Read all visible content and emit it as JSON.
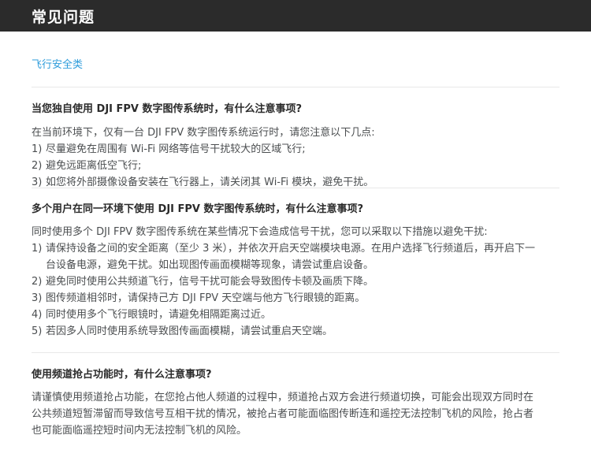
{
  "header": {
    "title": "常见问题"
  },
  "category": {
    "label": "飞行安全类"
  },
  "faqs": [
    {
      "question": "当您独自使用 DJI FPV 数字图传系统时，有什么注意事项?",
      "intro": "在当前环境下，仅有一台 DJI FPV 数字图传系统运行时，请您注意以下几点:",
      "items": [
        {
          "num": "1)",
          "text": "尽量避免在周围有 Wi-Fi 网络等信号干扰较大的区域飞行;"
        },
        {
          "num": "2)",
          "text": "避免远距离低空飞行;"
        },
        {
          "num": "3)",
          "text": "如您将外部摄像设备安装在飞行器上，请关闭其 Wi-Fi 模块，避免干扰。"
        }
      ]
    },
    {
      "question": "多个用户在同一环境下使用 DJI FPV 数字图传系统时，有什么注意事项?",
      "intro": "同时使用多个 DJI FPV 数字图传系统在某些情况下会造成信号干扰，您可以采取以下措施以避免干扰:",
      "items": [
        {
          "num": "1)",
          "text": "请保持设备之间的安全距离（至少 3 米），并依次开启天空端模块电源。在用户选择飞行频道后，再开启下一台设备电源，避免干扰。如出现图传画面模糊等现象，请尝试重启设备。"
        },
        {
          "num": "2)",
          "text": "避免同时使用公共频道飞行，信号干扰可能会导致图传卡顿及画质下降。"
        },
        {
          "num": "3)",
          "text": "图传频道相邻时，请保持己方 DJI FPV 天空端与他方飞行眼镜的距离。"
        },
        {
          "num": "4)",
          "text": "同时使用多个飞行眼镜时，请避免相隔距离过近。"
        },
        {
          "num": "5)",
          "text": "若因多人同时使用系统导致图传画面模糊，请尝试重启天空端。"
        }
      ]
    },
    {
      "question": "使用频道抢占功能时，有什么注意事项?",
      "intro": "请谨慎使用频道抢占功能，在您抢占他人频道的过程中，频道抢占双方会进行频道切换，可能会出现双方同时在公共频道短暂滞留而导致信号互相干扰的情况，被抢占者可能面临图传断连和遥控无法控制飞机的风险，抢占者也可能面临遥控短时间内无法控制飞机的风险。"
    }
  ]
}
